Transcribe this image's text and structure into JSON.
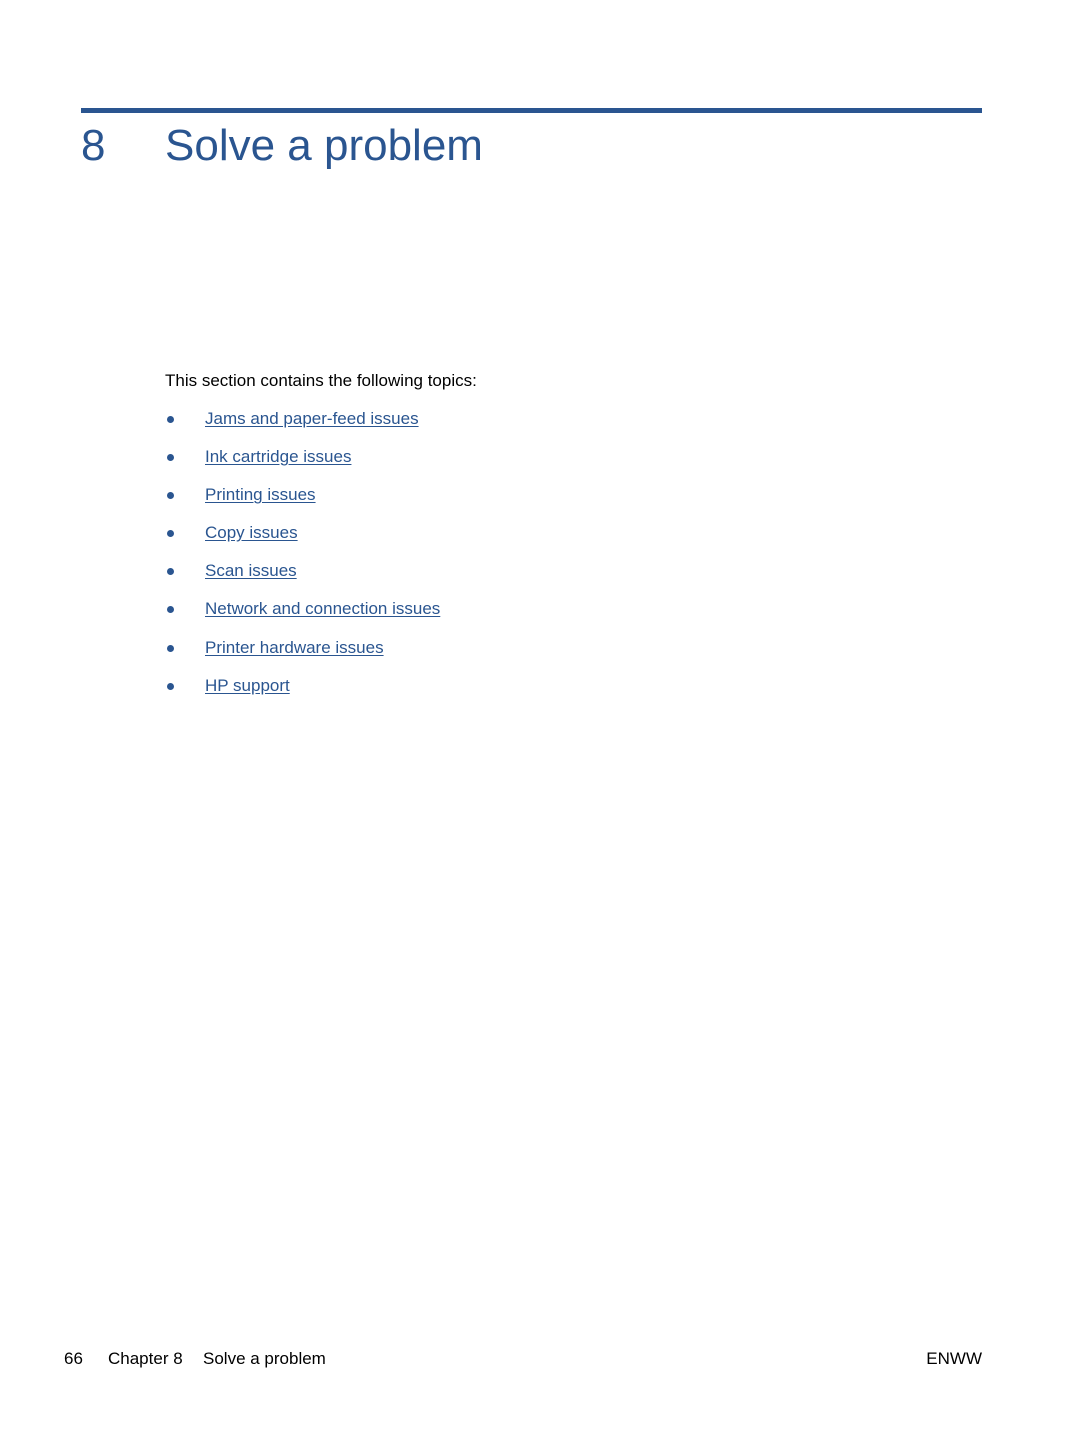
{
  "header": {
    "chapter_number": "8",
    "chapter_title": "Solve a problem",
    "accent_color": "#2a5590"
  },
  "intro": "This section contains the following topics:",
  "topics": [
    {
      "label": "Jams and paper-feed issues"
    },
    {
      "label": "Ink cartridge issues"
    },
    {
      "label": "Printing issues"
    },
    {
      "label": "Copy issues"
    },
    {
      "label": "Scan issues"
    },
    {
      "label": "Network and connection issues"
    },
    {
      "label": "Printer hardware issues"
    },
    {
      "label": "HP support"
    }
  ],
  "footer": {
    "page_number": "66",
    "chapter_label": "Chapter 8",
    "section_label": "Solve a problem",
    "locale_code": "ENWW"
  }
}
